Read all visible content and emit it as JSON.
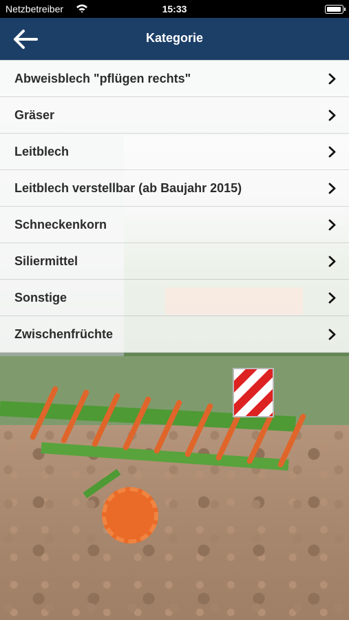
{
  "status_bar": {
    "carrier": "Netzbetreiber",
    "time": "15:33",
    "wifi_icon": "wifi-icon",
    "battery_icon": "battery-icon"
  },
  "nav": {
    "title": "Kategorie",
    "back_icon": "back-arrow-icon"
  },
  "colors": {
    "nav_background": "#1c3f67",
    "row_background": "#ffffff",
    "row_text": "#2b2b2b"
  },
  "categories": [
    {
      "label": "Abweisblech \"pflügen rechts\""
    },
    {
      "label": "Gräser"
    },
    {
      "label": "Leitblech"
    },
    {
      "label": "Leitblech verstellbar (ab Baujahr 2015)"
    },
    {
      "label": "Schneckenkorn"
    },
    {
      "label": "Siliermittel"
    },
    {
      "label": "Sonstige"
    },
    {
      "label": "Zwischenfrüchte"
    }
  ]
}
